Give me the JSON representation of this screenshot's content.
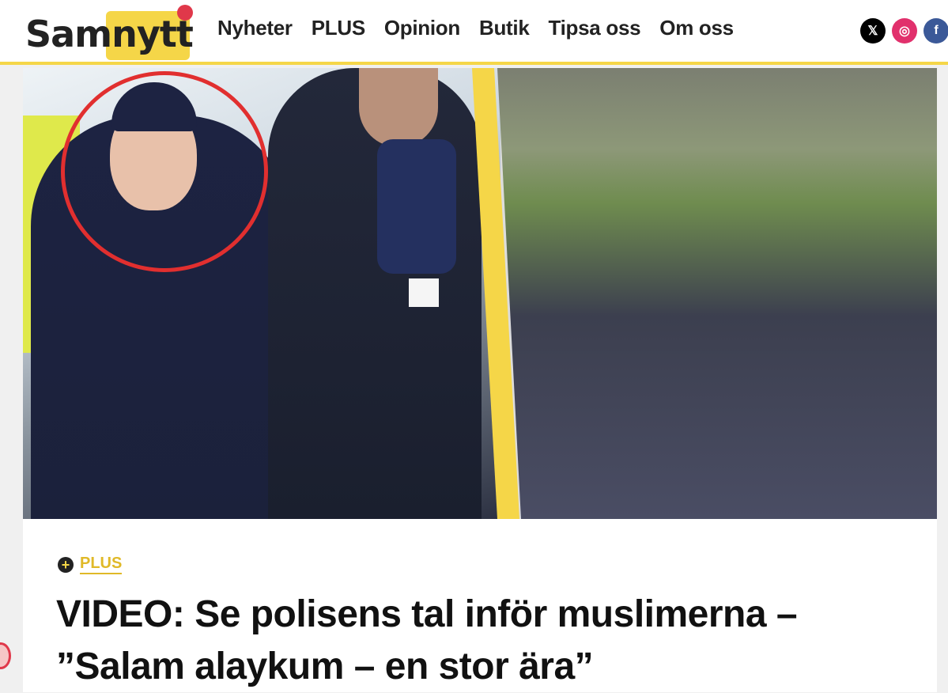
{
  "brand": {
    "logo_text": "Samnytt",
    "accent": "#f5d648",
    "dot": "#e0384a"
  },
  "nav": [
    {
      "label": "Nyheter"
    },
    {
      "label": "PLUS"
    },
    {
      "label": "Opinion"
    },
    {
      "label": "Butik"
    },
    {
      "label": "Tipsa oss"
    },
    {
      "label": "Om oss"
    }
  ],
  "social": [
    "x-icon",
    "instagram-icon",
    "facebook-icon"
  ],
  "article": {
    "tag": "PLUS",
    "headline": "VIDEO: Se polisens tal inför muslimerna – ”Salam alaykum – en stor ära”"
  }
}
